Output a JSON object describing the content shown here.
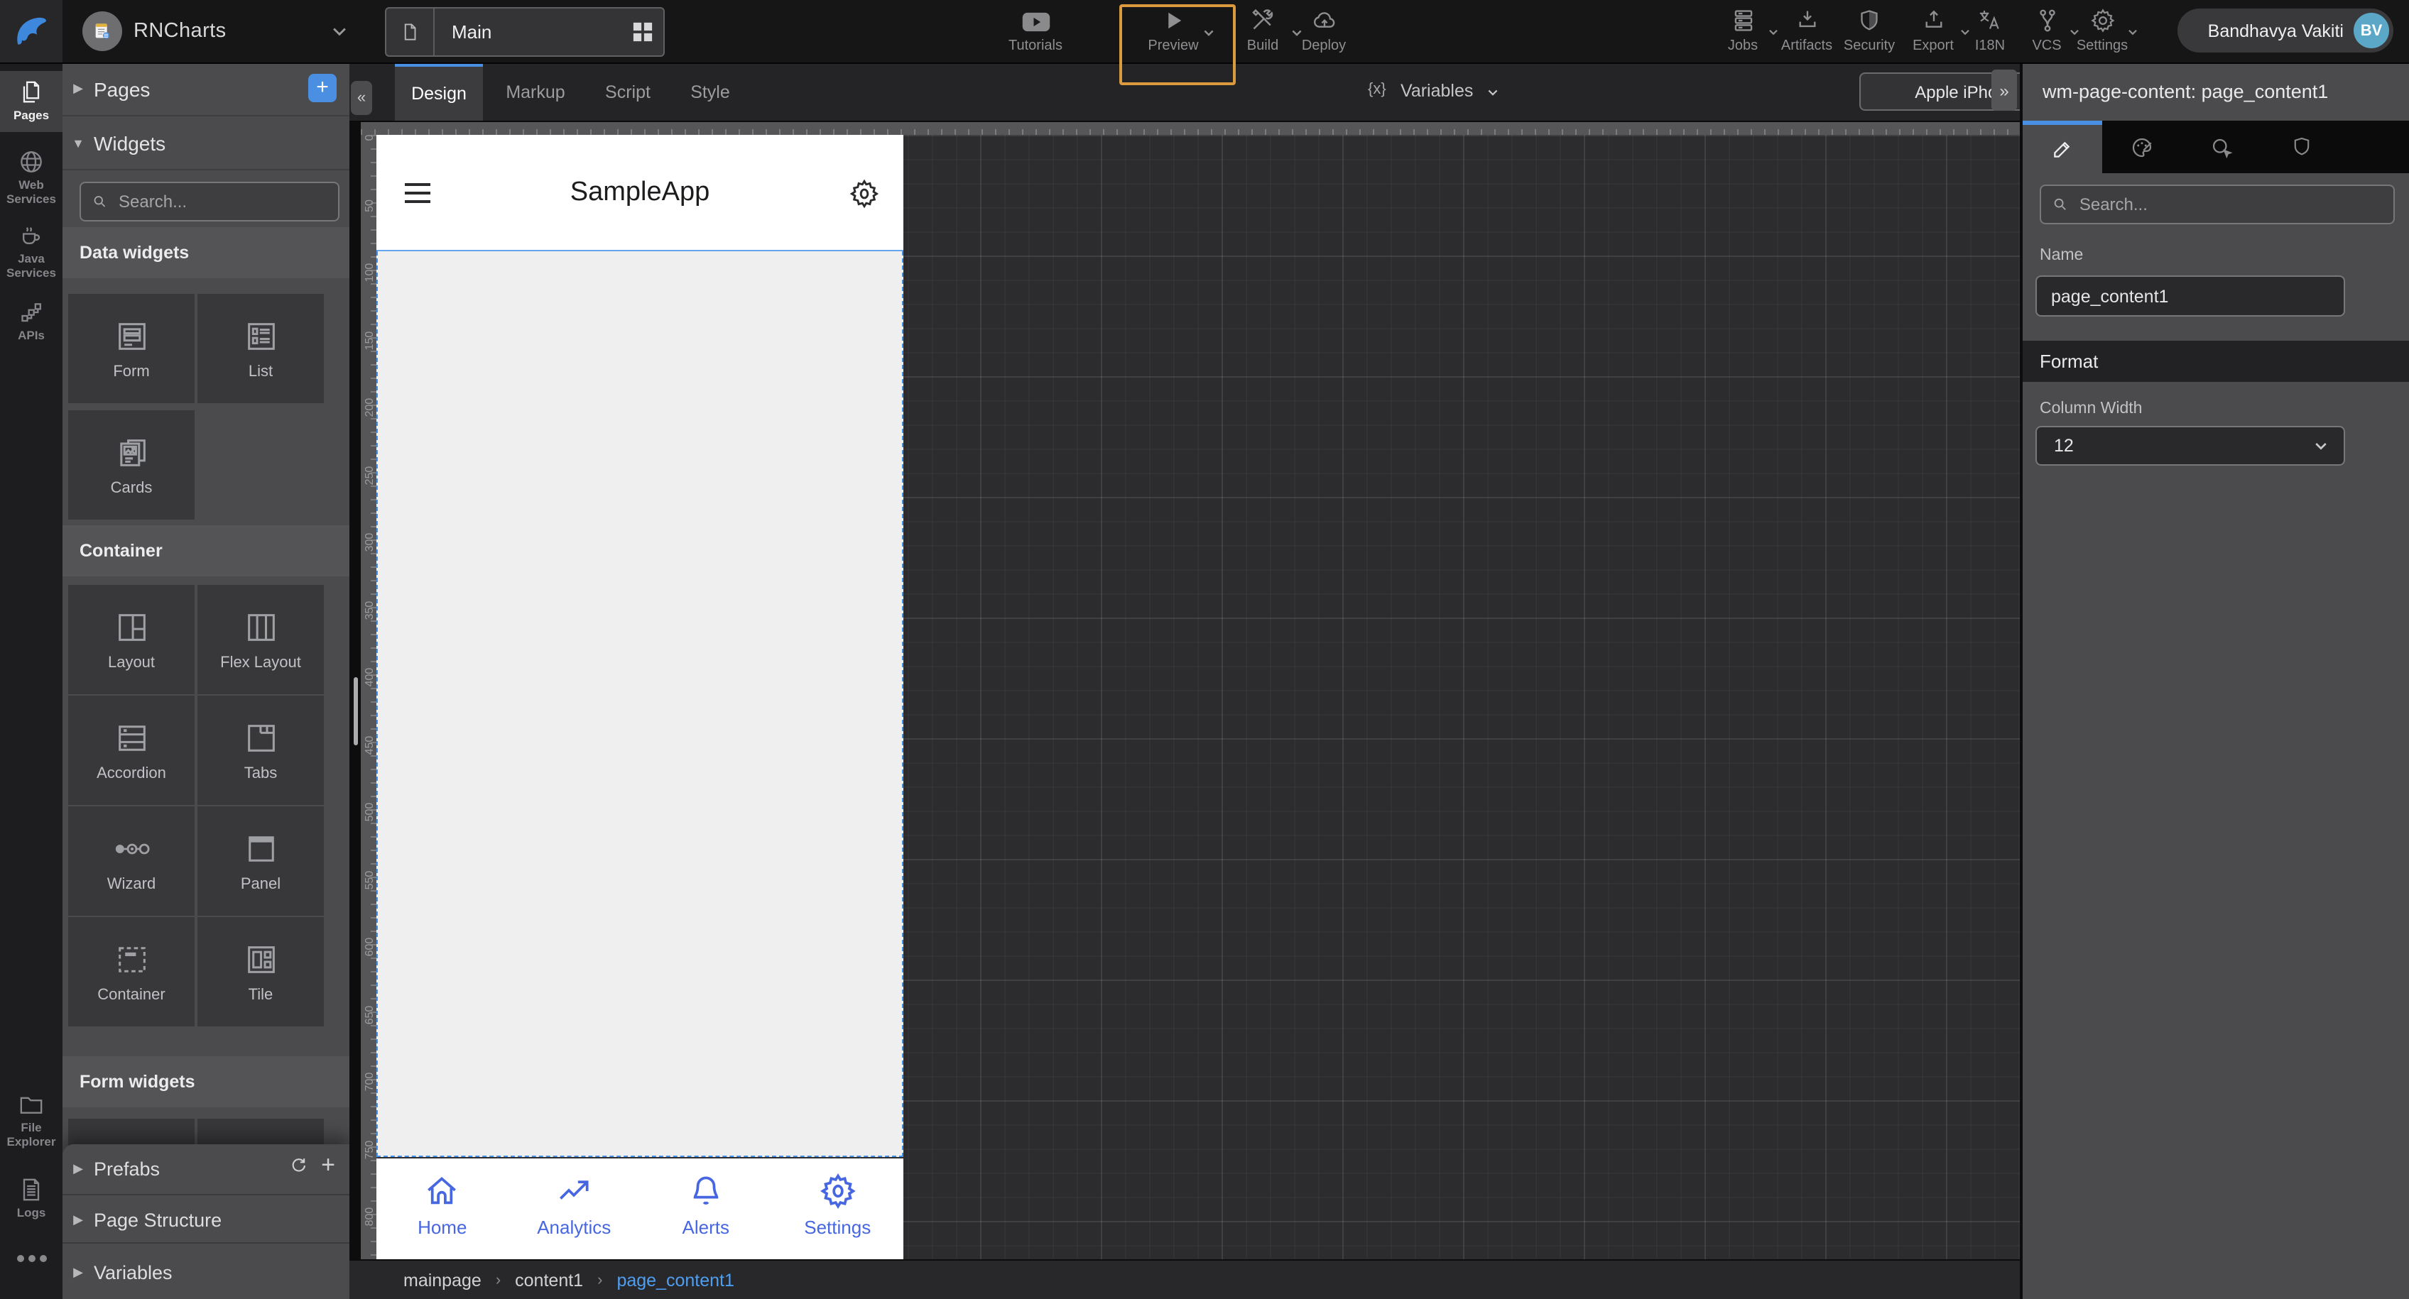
{
  "topbar": {
    "project_name": "RNCharts",
    "page_tab": "Main",
    "tutorials": "Tutorials",
    "preview": "Preview",
    "build": "Build",
    "deploy": "Deploy",
    "jobs": "Jobs",
    "artifacts": "Artifacts",
    "security": "Security",
    "export": "Export",
    "i18n": "I18N",
    "vcs": "VCS",
    "settings": "Settings",
    "user": {
      "name": "Bandhavya Vakiti",
      "initials": "BV"
    }
  },
  "rail": {
    "items": [
      {
        "line1": "Pages",
        "line2": "",
        "active": true
      },
      {
        "line1": "Web",
        "line2": "Services"
      },
      {
        "line1": "Java",
        "line2": "Services"
      },
      {
        "line1": "APIs",
        "line2": ""
      },
      {
        "line1": "File",
        "line2": "Explorer"
      },
      {
        "line1": "Logs",
        "line2": ""
      }
    ]
  },
  "left_panel": {
    "pages_title": "Pages",
    "widgets_title": "Widgets",
    "search_placeholder": "Search...",
    "sections": [
      {
        "title": "Data widgets",
        "items": [
          "Form",
          "List",
          "Cards"
        ]
      },
      {
        "title": "Container",
        "items": [
          "Layout",
          "Flex Layout",
          "Accordion",
          "Tabs",
          "Wizard",
          "Panel",
          "Container",
          "Tile"
        ]
      },
      {
        "title": "Form widgets",
        "items": []
      }
    ],
    "accordions": [
      {
        "label": "Prefabs"
      },
      {
        "label": "Page Structure"
      },
      {
        "label": "Variables"
      }
    ]
  },
  "toolbar": {
    "tabs": [
      {
        "label": "Design"
      },
      {
        "label": "Markup"
      },
      {
        "label": "Script"
      },
      {
        "label": "Style"
      }
    ],
    "active_tab": "Design",
    "variables_prefix": "{x}",
    "variables_label": "Variables",
    "device": "Apple iPhone X"
  },
  "phone": {
    "title": "SampleApp",
    "nav_items": [
      {
        "label": "Home"
      },
      {
        "label": "Analytics"
      },
      {
        "label": "Alerts"
      },
      {
        "label": "Settings"
      }
    ]
  },
  "breadcrumb": {
    "items": [
      "mainpage",
      "content1",
      "page_content1"
    ],
    "active": "page_content1"
  },
  "right_panel": {
    "title": "wm-page-content: page_content1",
    "search_placeholder": "Search...",
    "name_label": "Name",
    "name_value": "page_content1",
    "format_label": "Format",
    "column_width_label": "Column Width",
    "column_width_value": "12"
  },
  "canvas": {
    "ruler_values": [
      0,
      50,
      100,
      150,
      200,
      250,
      300,
      350,
      400,
      450,
      500,
      550,
      600,
      650,
      700,
      750,
      800
    ]
  },
  "colors": {
    "accent_blue": "#4a90e2",
    "phone_nav_blue": "#4767e2",
    "focus_orange": "#dc9a3e",
    "breadcrumb_active": "#4e9ef2",
    "avatar_teal": "#5ba7c7"
  }
}
